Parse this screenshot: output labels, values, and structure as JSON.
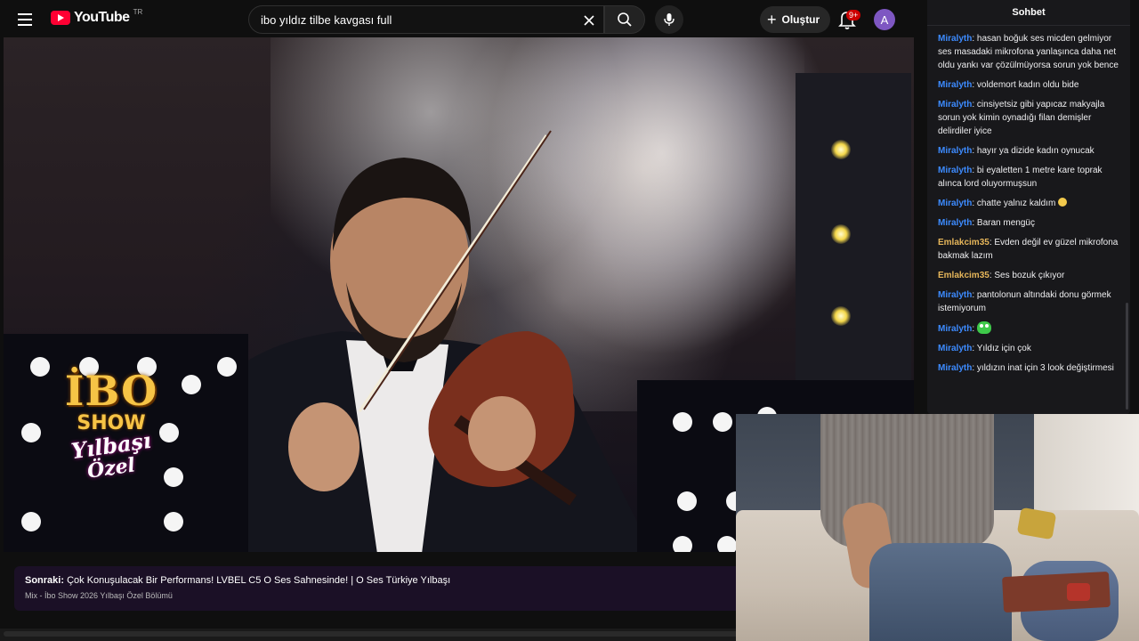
{
  "youtube": {
    "logo_text": "YouTube",
    "region": "TR",
    "search": {
      "value": "ibo yıldız tilbe kavgası full"
    },
    "create_label": "Oluştur",
    "notification_count": "9+",
    "avatar_letter": "A",
    "brand_color": "#ff0033"
  },
  "show_logo": {
    "line1": "İBO",
    "line2": "SHOW",
    "line3": "Yılbaşı",
    "line4": "Özel"
  },
  "up_next": {
    "prefix": "Sonraki:",
    "title": "Çok Konuşulacak Bir Performans! LVBEL C5 O Ses Sahnesinde! | O Ses Türkiye Yılbaşı",
    "subtitle": "Mix - İbo Show 2026 Yılbaşı Özel Bölümü"
  },
  "chat": {
    "title": "Sohbet",
    "messages": [
      {
        "user": "Miralyth",
        "color": "blue",
        "text": "hasan boğuk ses micden gelmiyor ses masadaki mikrofona yanlaşınca daha net oldu yankı var çözülmüyorsa sorun yok bence"
      },
      {
        "user": "Miralyth",
        "color": "blue",
        "text": "voldemort kadın oldu bide"
      },
      {
        "user": "Miralyth",
        "color": "blue",
        "text": "cinsiyetsiz gibi yapıcaz makyajla sorun yok kimin oynadığı filan demişler delirdiler iyice"
      },
      {
        "user": "Miralyth",
        "color": "blue",
        "text": "hayır ya dizide kadın oynucak"
      },
      {
        "user": "Miralyth",
        "color": "blue",
        "text": "bi eyaletten 1 metre kare toprak alınca lord oluyormuşsun"
      },
      {
        "user": "Miralyth",
        "color": "blue",
        "text": "chatte yalnız kaldım"
      },
      {
        "user": "Miralyth",
        "color": "blue",
        "text": "Baran mengüç"
      },
      {
        "user": "Emlakcim35",
        "color": "yellow",
        "text": "Evden değil ev güzel mikrofona bakmak lazım"
      },
      {
        "user": "Emlakcim35",
        "color": "yellow",
        "text": "Ses bozuk çıkıyor"
      },
      {
        "user": "Miralyth",
        "color": "blue",
        "text": "pantolonun altındaki donu görmek istemiyorum"
      },
      {
        "user": "Miralyth",
        "color": "blue",
        "text": ""
      },
      {
        "user": "Miralyth",
        "color": "blue",
        "text": "Yıldız için çok"
      },
      {
        "user": "Miralyth",
        "color": "blue",
        "text": "yıldızın inat için 3 look değiştirmesi"
      }
    ],
    "user_colors": {
      "blue": "#3d8bff",
      "yellow": "#e6b65a"
    }
  }
}
